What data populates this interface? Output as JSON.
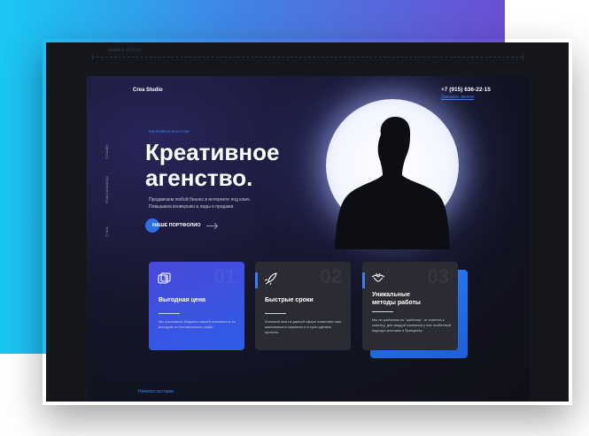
{
  "canvas": {
    "ruler_label": "Ширина 1920 px"
  },
  "header": {
    "logo": "Crea Studio",
    "phone": "+7 (915) 636-22-15",
    "callback_link": "Заказать звонок"
  },
  "vertical_nav": [
    "Отзывы",
    "Наша команда",
    "О нас"
  ],
  "hero": {
    "eyebrow": "Креативное агентство",
    "title_line1": "Креативное",
    "title_line2": "агенство.",
    "subtitle_line1": "Продвигаем любой бизнес в интернете под ключ.",
    "subtitle_line2": "Повышаем конверсию в лиды и продажи.",
    "cta_label": "НАШЕ ПОРТФОЛИО"
  },
  "cards": [
    {
      "number": "01",
      "icon": "dollar-tag-icon",
      "title": "Выгодная цена",
      "text": "Мы учитываем бюджеты вашей компании и не выходим за поставленные рамки"
    },
    {
      "number": "02",
      "icon": "rocket-icon",
      "title": "Быстрые сроки",
      "text": "Большой опыт в данной сфере позволяет нам максимально сервисно и в срок сделать проекты"
    },
    {
      "number": "03",
      "icon": "handshake-icon",
      "title_line1": "Уникальные",
      "title_line2": "методы работы",
      "text": "Мы не работаем по \"шаблону\", от клиента к клиенту, для каждой компании у нас особенный подход к рекламе и брендингу"
    }
  ],
  "footer": {
    "link": "Немного истории"
  },
  "colors": {
    "accent": "#3f7de8",
    "card_gradient_start": "#4a48d9",
    "card_gradient_end": "#2e5de8",
    "card_dark": "#2b2c33",
    "background_top": "#19c8f4",
    "background_end": "#6a4fd2"
  }
}
